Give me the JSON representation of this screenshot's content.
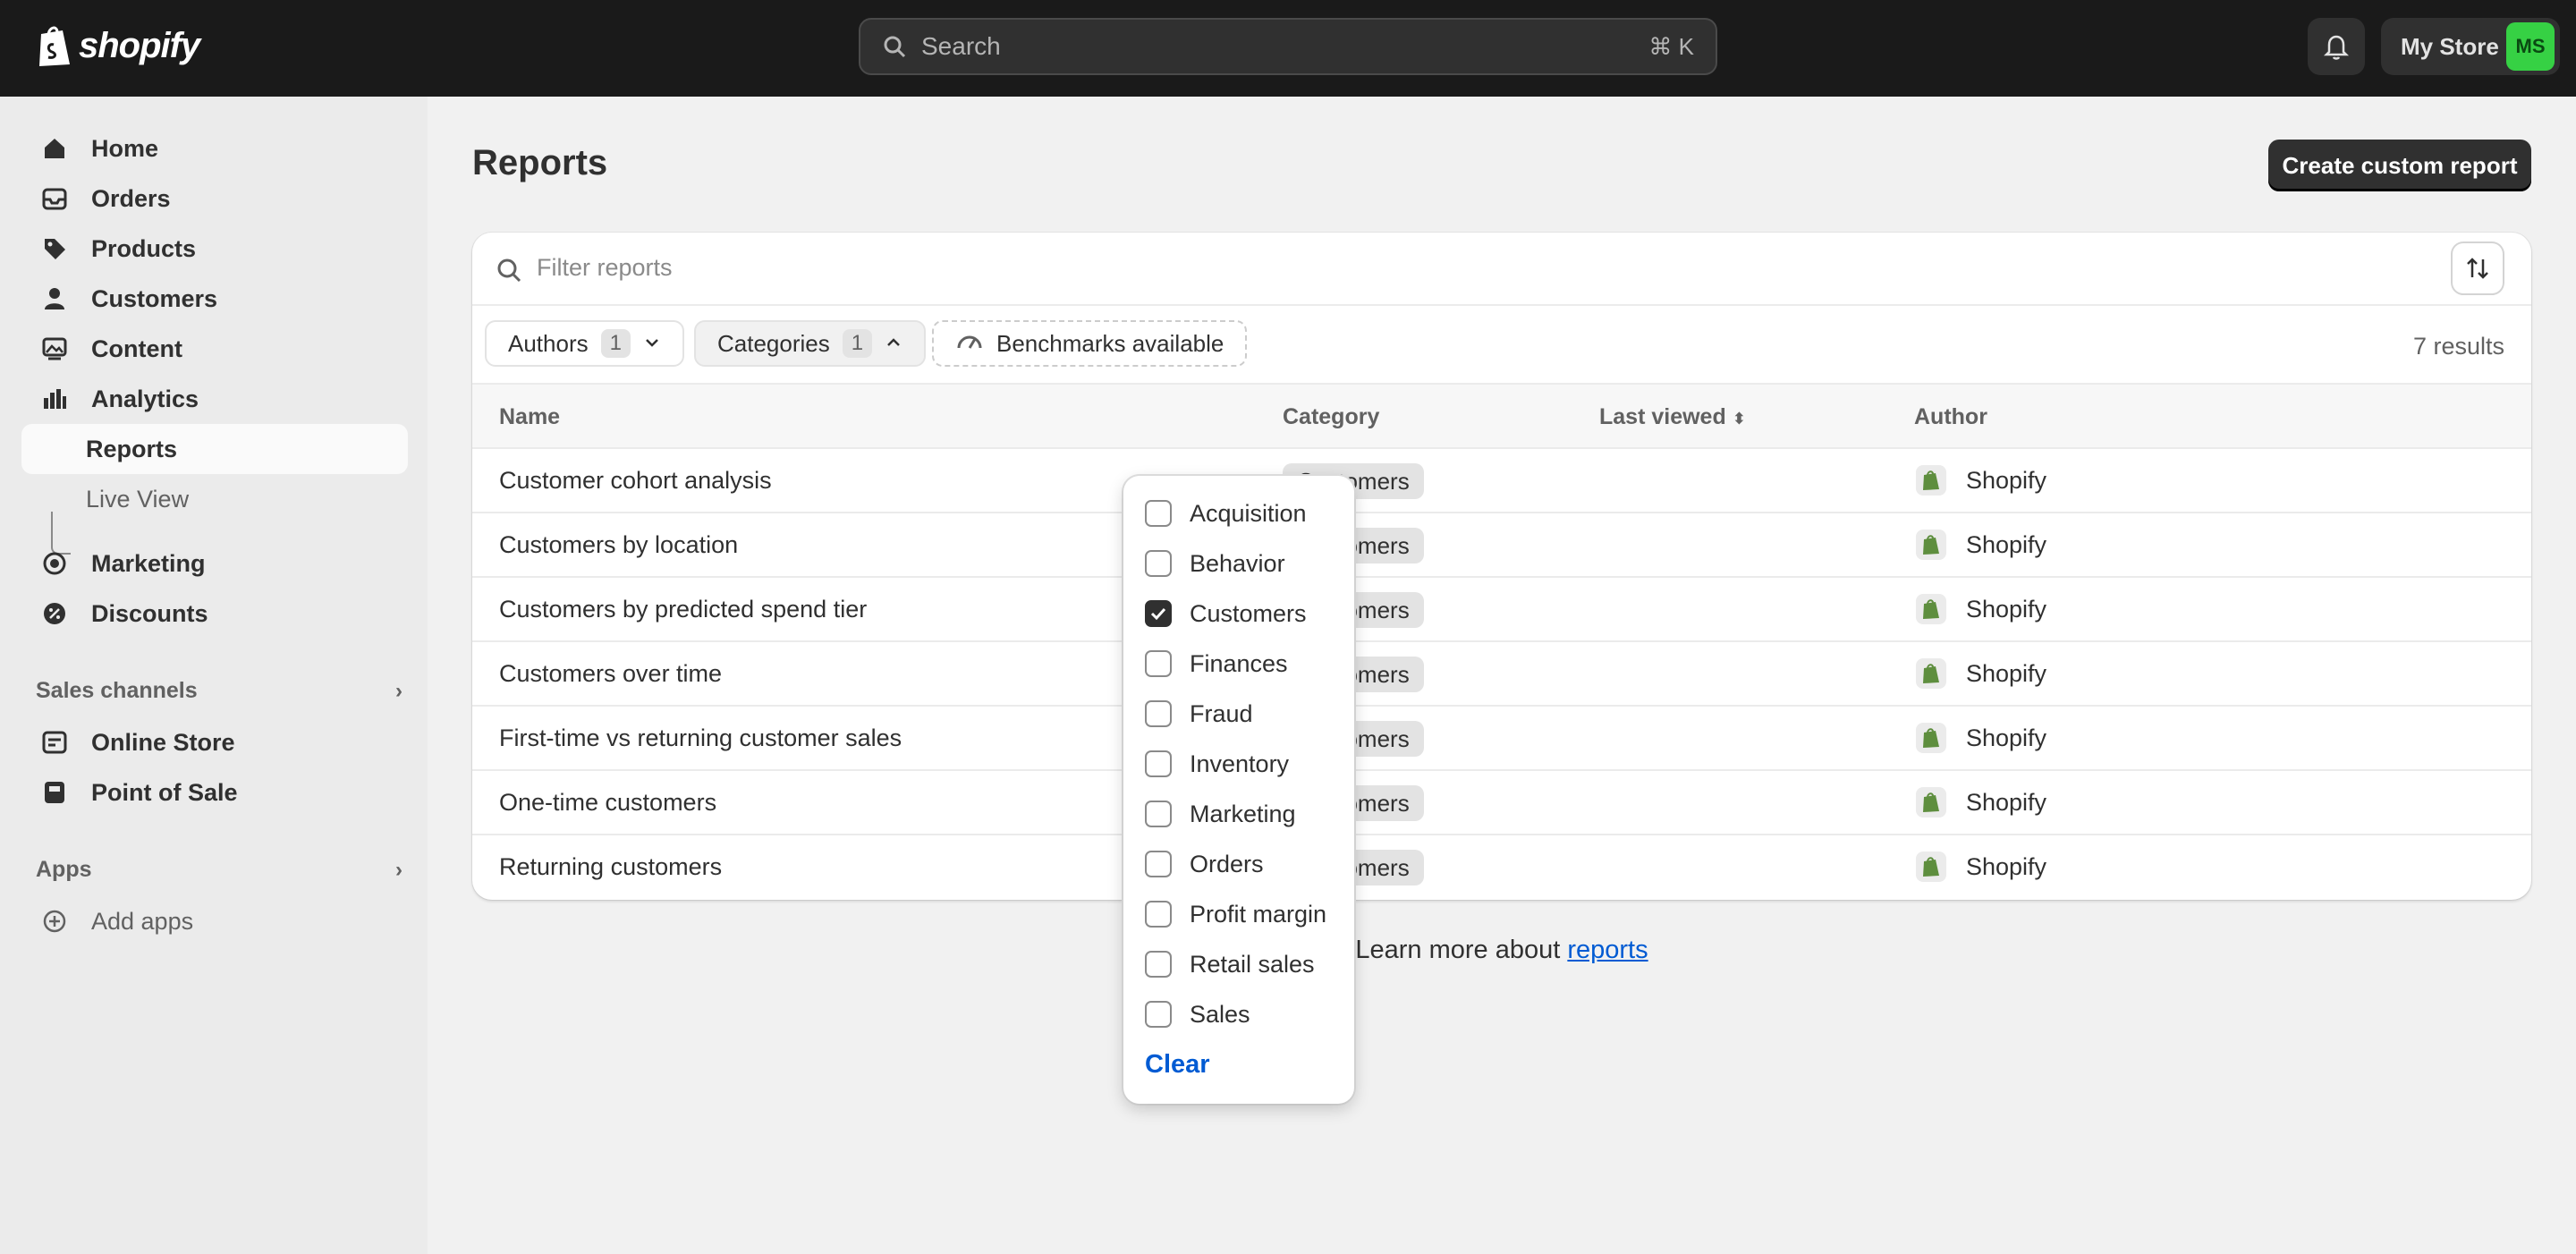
{
  "topbar": {
    "brand": "shopify",
    "search_placeholder": "Search",
    "search_shortcut": "⌘ K",
    "store_name": "My Store",
    "avatar_initials": "MS"
  },
  "sidebar": {
    "items": [
      {
        "label": "Home",
        "icon": "home-icon"
      },
      {
        "label": "Orders",
        "icon": "inbox-icon"
      },
      {
        "label": "Products",
        "icon": "tag-icon"
      },
      {
        "label": "Customers",
        "icon": "person-icon"
      },
      {
        "label": "Content",
        "icon": "image-icon"
      },
      {
        "label": "Analytics",
        "icon": "bar-chart-icon"
      },
      {
        "label": "Reports"
      },
      {
        "label": "Live View"
      },
      {
        "label": "Marketing",
        "icon": "target-icon"
      },
      {
        "label": "Discounts",
        "icon": "discount-icon"
      }
    ],
    "sales_channels_title": "Sales channels",
    "sales_channels": [
      {
        "label": "Online Store",
        "icon": "store-icon"
      },
      {
        "label": "Point of Sale",
        "icon": "pos-icon"
      }
    ],
    "apps_title": "Apps",
    "add_apps_label": "Add apps"
  },
  "page": {
    "title": "Reports",
    "create_button": "Create custom report",
    "filter_placeholder": "Filter reports",
    "results": "7 results",
    "learn_more_prefix": "Learn more about ",
    "learn_more_link": "reports"
  },
  "filters": {
    "authors_label": "Authors",
    "authors_count": "1",
    "categories_label": "Categories",
    "categories_count": "1",
    "benchmarks_label": "Benchmarks available"
  },
  "table": {
    "headers": {
      "name": "Name",
      "category": "Category",
      "last_viewed": "Last viewed",
      "author": "Author"
    },
    "rows": [
      {
        "name": "Customer cohort analysis",
        "category": "Customers",
        "author": "Shopify"
      },
      {
        "name": "Customers by location",
        "category": "Customers",
        "author": "Shopify"
      },
      {
        "name": "Customers by predicted spend tier",
        "category": "Customers",
        "author": "Shopify"
      },
      {
        "name": "Customers over time",
        "category": "Customers",
        "author": "Shopify"
      },
      {
        "name": "First-time vs returning customer sales",
        "category": "Customers",
        "author": "Shopify"
      },
      {
        "name": "One-time customers",
        "category": "Customers",
        "author": "Shopify"
      },
      {
        "name": "Returning customers",
        "category": "Customers",
        "author": "Shopify"
      }
    ]
  },
  "categories_popover": {
    "options": [
      {
        "label": "Acquisition",
        "checked": false
      },
      {
        "label": "Behavior",
        "checked": false
      },
      {
        "label": "Customers",
        "checked": true
      },
      {
        "label": "Finances",
        "checked": false
      },
      {
        "label": "Fraud",
        "checked": false
      },
      {
        "label": "Inventory",
        "checked": false
      },
      {
        "label": "Marketing",
        "checked": false
      },
      {
        "label": "Orders",
        "checked": false
      },
      {
        "label": "Profit margin",
        "checked": false
      },
      {
        "label": "Retail sales",
        "checked": false
      },
      {
        "label": "Sales",
        "checked": false
      }
    ],
    "clear_label": "Clear"
  },
  "colors": {
    "accent_green": "#36d144",
    "link_blue": "#005bd3",
    "topbar": "#1a1a1a"
  }
}
